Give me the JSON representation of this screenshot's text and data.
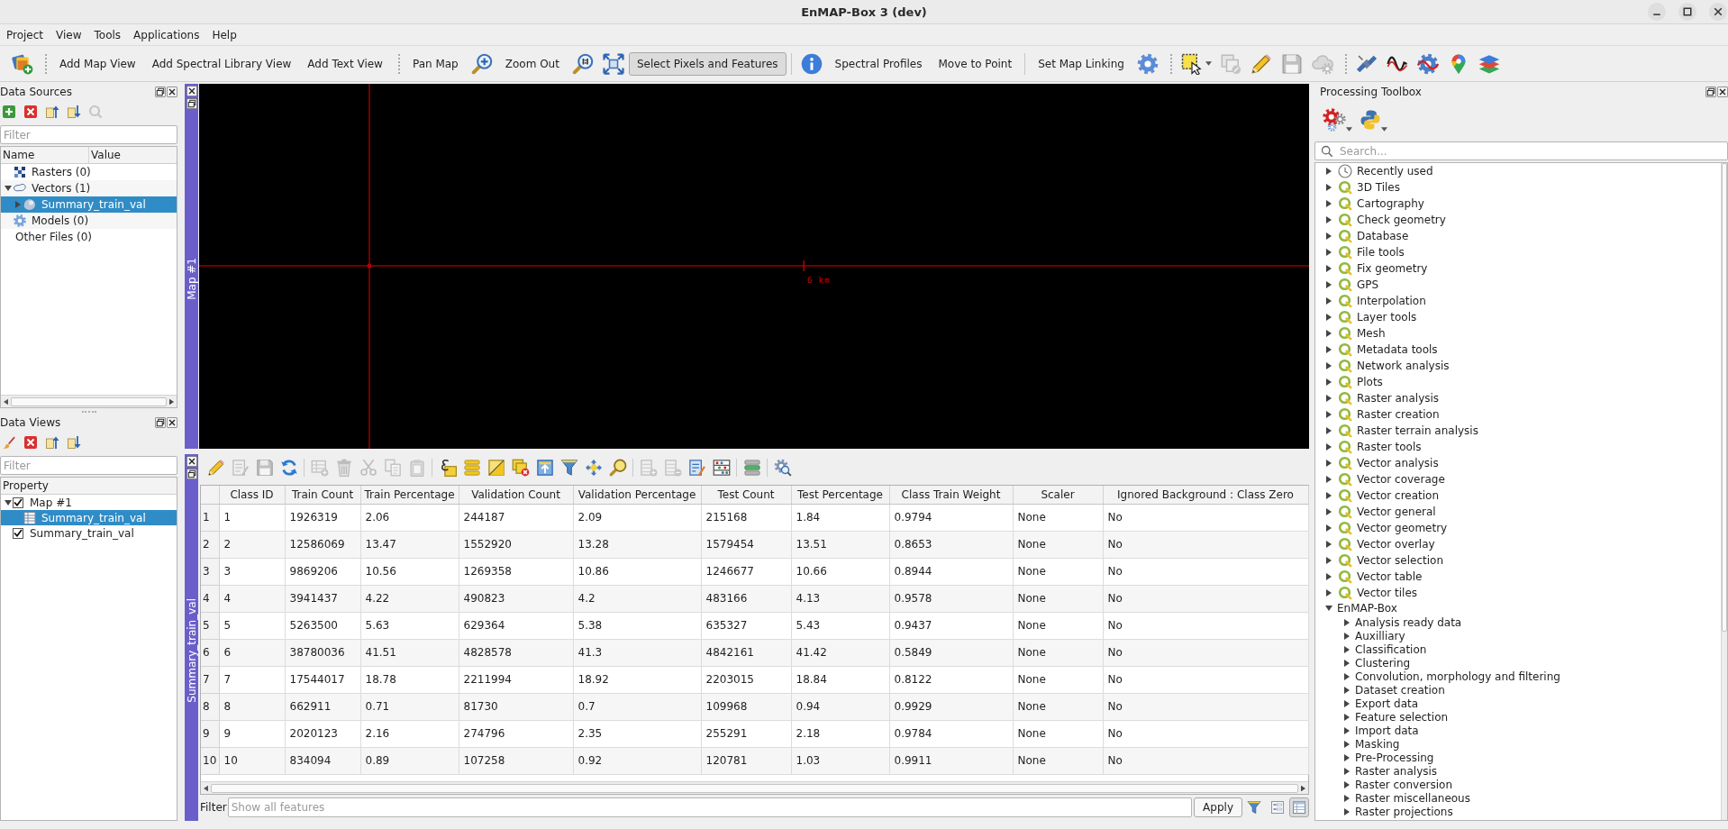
{
  "window": {
    "title": "EnMAP-Box 3 (dev)"
  },
  "menu": [
    "Project",
    "View",
    "Tools",
    "Applications",
    "Help"
  ],
  "toolbar": [
    {
      "kind": "icon",
      "disabled": false
    },
    {
      "kind": "handle"
    },
    {
      "kind": "text",
      "label": "Add Map View",
      "selected": false
    },
    {
      "kind": "text",
      "label": "Add Spectral Library View",
      "selected": false
    },
    {
      "kind": "text",
      "label": "Add Text View",
      "selected": false
    },
    {
      "kind": "handle"
    },
    {
      "kind": "text",
      "label": "Pan Map",
      "selected": false
    },
    {
      "kind": "icon",
      "disabled": false
    },
    {
      "kind": "text",
      "label": "Zoom Out",
      "selected": false
    },
    {
      "kind": "icon",
      "disabled": false
    },
    {
      "kind": "icon",
      "disabled": false
    },
    {
      "kind": "text",
      "label": "Select Pixels and Features",
      "selected": true
    },
    {
      "kind": "separator"
    },
    {
      "kind": "icon",
      "disabled": false
    },
    {
      "kind": "text",
      "label": "Spectral Profiles",
      "selected": false
    },
    {
      "kind": "text",
      "label": "Move to Point",
      "selected": false
    },
    {
      "kind": "separator"
    },
    {
      "kind": "text",
      "label": "Set Map Linking",
      "selected": false
    },
    {
      "kind": "icon",
      "disabled": false
    },
    {
      "kind": "handle"
    },
    {
      "kind": "icon",
      "disabled": false
    },
    {
      "kind": "icon",
      "disabled": true
    },
    {
      "kind": "icon",
      "disabled": false
    },
    {
      "kind": "icon",
      "disabled": true
    },
    {
      "kind": "icon",
      "disabled": true
    },
    {
      "kind": "handle"
    },
    {
      "kind": "icon",
      "disabled": false
    },
    {
      "kind": "icon",
      "disabled": false
    },
    {
      "kind": "icon",
      "disabled": false
    },
    {
      "kind": "icon",
      "disabled": false
    },
    {
      "kind": "icon",
      "disabled": false
    }
  ],
  "data_sources": {
    "title": "Data Sources",
    "tools": [
      {
        "disabled": false
      },
      {
        "disabled": false
      },
      {
        "disabled": false
      },
      {
        "disabled": false
      },
      {
        "disabled": true
      }
    ],
    "filter_placeholder": "Filter",
    "columns": [
      "Name",
      "Value"
    ],
    "items": [
      {
        "label": "Rasters (0)",
        "kind": "raster",
        "selected": false
      },
      {
        "label": "Vectors (1)",
        "kind": "vector",
        "expanded": true,
        "selected": false,
        "children": [
          {
            "label": "Summary_train_val",
            "kind": "layer",
            "expanded": false,
            "selected": true
          }
        ]
      },
      {
        "label": "Models (0)",
        "kind": "model",
        "selected": false
      },
      {
        "label": "Other Files (0)",
        "kind": "file",
        "selected": false
      }
    ]
  },
  "data_views": {
    "title": "Data Views",
    "tools": [
      {
        "disabled": false
      },
      {
        "disabled": false
      },
      {
        "disabled": false
      },
      {
        "disabled": false
      }
    ],
    "filter_placeholder": "Filter",
    "columns": [
      "Property"
    ],
    "items": [
      {
        "label": "Map #1",
        "kind": "dock",
        "checked": true,
        "expanded": true,
        "selected": false,
        "children": [
          {
            "label": "Summary_train_val",
            "kind": "layer",
            "selected": true
          }
        ]
      },
      {
        "label": "Summary_train_val",
        "kind": "dock",
        "checked": true,
        "selected": false
      }
    ]
  },
  "map": {
    "title": "Map #1",
    "scale_label": "6 km"
  },
  "table_view": {
    "title": "Summary_train_val",
    "tools": [
      {
        "kind": "icon",
        "disabled": false
      },
      {
        "kind": "icon",
        "disabled": true
      },
      {
        "kind": "icon",
        "disabled": true
      },
      {
        "kind": "icon",
        "disabled": false
      },
      {
        "kind": "separator"
      },
      {
        "kind": "icon",
        "disabled": true
      },
      {
        "kind": "icon",
        "disabled": true
      },
      {
        "kind": "icon",
        "disabled": true
      },
      {
        "kind": "icon",
        "disabled": true
      },
      {
        "kind": "icon",
        "disabled": true
      },
      {
        "kind": "separator"
      },
      {
        "kind": "icon",
        "disabled": false
      },
      {
        "kind": "icon",
        "disabled": false
      },
      {
        "kind": "icon",
        "disabled": false
      },
      {
        "kind": "icon",
        "disabled": false
      },
      {
        "kind": "icon",
        "disabled": false
      },
      {
        "kind": "icon",
        "disabled": false
      },
      {
        "kind": "icon",
        "disabled": false
      },
      {
        "kind": "icon",
        "disabled": false
      },
      {
        "kind": "separator"
      },
      {
        "kind": "icon",
        "disabled": true
      },
      {
        "kind": "icon",
        "disabled": true
      },
      {
        "kind": "icon",
        "disabled": false
      },
      {
        "kind": "icon",
        "disabled": false
      },
      {
        "kind": "separator"
      },
      {
        "kind": "icon",
        "disabled": false
      },
      {
        "kind": "separator"
      },
      {
        "kind": "icon",
        "disabled": false
      }
    ],
    "columns": [
      "Class ID",
      "Train Count",
      "Train Percentage",
      "Validation Count",
      "Validation Percentage",
      "Test Count",
      "Test Percentage",
      "Class Train Weight",
      "Scaler",
      "Ignored Background : Class Zero"
    ],
    "rows": [
      {
        "header": "1",
        "selected": false,
        "cells": [
          "1",
          "1926319",
          "2.06",
          "244187",
          "2.09",
          "215168",
          "1.84",
          "0.9794",
          "None",
          "No"
        ]
      },
      {
        "header": "2",
        "selected": false,
        "cells": [
          "2",
          "12586069",
          "13.47",
          "1552920",
          "13.28",
          "1579454",
          "13.51",
          "0.8653",
          "None",
          "No"
        ]
      },
      {
        "header": "3",
        "selected": false,
        "cells": [
          "3",
          "9869206",
          "10.56",
          "1269358",
          "10.86",
          "1246677",
          "10.66",
          "0.8944",
          "None",
          "No"
        ]
      },
      {
        "header": "4",
        "selected": false,
        "cells": [
          "4",
          "3941437",
          "4.22",
          "490823",
          "4.2",
          "483166",
          "4.13",
          "0.9578",
          "None",
          "No"
        ]
      },
      {
        "header": "5",
        "selected": false,
        "cells": [
          "5",
          "5263500",
          "5.63",
          "629364",
          "5.38",
          "635327",
          "5.43",
          "0.9437",
          "None",
          "No"
        ]
      },
      {
        "header": "6",
        "selected": false,
        "cells": [
          "6",
          "38780036",
          "41.51",
          "4828578",
          "41.3",
          "4842161",
          "41.42",
          "0.5849",
          "None",
          "No"
        ]
      },
      {
        "header": "7",
        "selected": false,
        "cells": [
          "7",
          "17544017",
          "18.78",
          "2211994",
          "18.92",
          "2203015",
          "18.84",
          "0.8122",
          "None",
          "No"
        ]
      },
      {
        "header": "8",
        "selected": false,
        "cells": [
          "8",
          "662911",
          "0.71",
          "81730",
          "0.7",
          "109968",
          "0.94",
          "0.9929",
          "None",
          "No"
        ]
      },
      {
        "header": "9",
        "selected": false,
        "cells": [
          "9",
          "2020123",
          "2.16",
          "274796",
          "2.35",
          "255291",
          "2.18",
          "0.9784",
          "None",
          "No"
        ]
      },
      {
        "header": "10",
        "selected": false,
        "cells": [
          "10",
          "834094",
          "0.89",
          "107258",
          "0.92",
          "120781",
          "1.03",
          "0.9911",
          "None",
          "No"
        ]
      }
    ],
    "filter_label": "Filter",
    "filter_placeholder": "Show all features",
    "apply": "Apply",
    "view_modes": [
      {
        "selected": false
      },
      {
        "selected": true
      }
    ]
  },
  "processing_toolbox": {
    "title": "Processing Toolbox",
    "search_placeholder": "Search...",
    "items": [
      {
        "label": "Recently used",
        "kind": "history",
        "expanded": false,
        "selected": false
      },
      {
        "label": "3D Tiles",
        "kind": "native",
        "expanded": false,
        "selected": false
      },
      {
        "label": "Cartography",
        "kind": "native",
        "expanded": false,
        "selected": false
      },
      {
        "label": "Check geometry",
        "kind": "native",
        "expanded": false,
        "selected": false
      },
      {
        "label": "Database",
        "kind": "native",
        "expanded": false,
        "selected": false
      },
      {
        "label": "File tools",
        "kind": "native",
        "expanded": false,
        "selected": false
      },
      {
        "label": "Fix geometry",
        "kind": "native",
        "expanded": false,
        "selected": false
      },
      {
        "label": "GPS",
        "kind": "native",
        "expanded": false,
        "selected": false
      },
      {
        "label": "Interpolation",
        "kind": "native",
        "expanded": false,
        "selected": false
      },
      {
        "label": "Layer tools",
        "kind": "native",
        "expanded": false,
        "selected": false
      },
      {
        "label": "Mesh",
        "kind": "native",
        "expanded": false,
        "selected": false
      },
      {
        "label": "Metadata tools",
        "kind": "native",
        "expanded": false,
        "selected": false
      },
      {
        "label": "Network analysis",
        "kind": "native",
        "expanded": false,
        "selected": false
      },
      {
        "label": "Plots",
        "kind": "native",
        "expanded": false,
        "selected": false
      },
      {
        "label": "Raster analysis",
        "kind": "native",
        "expanded": false,
        "selected": false
      },
      {
        "label": "Raster creation",
        "kind": "native",
        "expanded": false,
        "selected": false
      },
      {
        "label": "Raster terrain analysis",
        "kind": "native",
        "expanded": false,
        "selected": false
      },
      {
        "label": "Raster tools",
        "kind": "native",
        "expanded": false,
        "selected": false
      },
      {
        "label": "Vector analysis",
        "kind": "native",
        "expanded": false,
        "selected": false
      },
      {
        "label": "Vector coverage",
        "kind": "native",
        "expanded": false,
        "selected": false
      },
      {
        "label": "Vector creation",
        "kind": "native",
        "expanded": false,
        "selected": false
      },
      {
        "label": "Vector general",
        "kind": "native",
        "expanded": false,
        "selected": false
      },
      {
        "label": "Vector geometry",
        "kind": "native",
        "expanded": false,
        "selected": false
      },
      {
        "label": "Vector overlay",
        "kind": "native",
        "expanded": false,
        "selected": false
      },
      {
        "label": "Vector selection",
        "kind": "native",
        "expanded": false,
        "selected": false
      },
      {
        "label": "Vector table",
        "kind": "native",
        "expanded": false,
        "selected": false
      },
      {
        "label": "Vector tiles",
        "kind": "native",
        "expanded": false,
        "selected": false
      },
      {
        "label": "EnMAP-Box",
        "kind": "provider",
        "expanded": true,
        "selected": false,
        "children": [
          {
            "label": "Analysis ready data",
            "kind": "group",
            "expanded": false,
            "selected": false
          },
          {
            "label": "Auxilliary",
            "kind": "group",
            "expanded": false,
            "selected": false
          },
          {
            "label": "Classification",
            "kind": "group",
            "expanded": false,
            "selected": false
          },
          {
            "label": "Clustering",
            "kind": "group",
            "expanded": false,
            "selected": false
          },
          {
            "label": "Convolution, morphology and filtering",
            "kind": "group",
            "expanded": false,
            "selected": false
          },
          {
            "label": "Dataset creation",
            "kind": "group",
            "expanded": false,
            "selected": false
          },
          {
            "label": "Export data",
            "kind": "group",
            "expanded": false,
            "selected": false
          },
          {
            "label": "Feature selection",
            "kind": "group",
            "expanded": false,
            "selected": false
          },
          {
            "label": "Import data",
            "kind": "group",
            "expanded": false,
            "selected": false
          },
          {
            "label": "Masking",
            "kind": "group",
            "expanded": false,
            "selected": false
          },
          {
            "label": "Pre-Processing",
            "kind": "group",
            "expanded": false,
            "selected": false
          },
          {
            "label": "Raster analysis",
            "kind": "group",
            "expanded": false,
            "selected": false
          },
          {
            "label": "Raster conversion",
            "kind": "group",
            "expanded": false,
            "selected": false
          },
          {
            "label": "Raster miscellaneous",
            "kind": "group",
            "expanded": false,
            "selected": false
          },
          {
            "label": "Raster projections",
            "kind": "group",
            "expanded": false,
            "selected": false
          }
        ]
      }
    ]
  }
}
